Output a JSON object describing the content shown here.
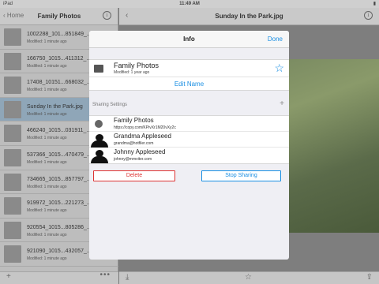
{
  "status": {
    "carrier": "iPad",
    "time": "11:49 AM",
    "battery": "▮"
  },
  "left": {
    "back_label": "Home",
    "title": "Family Photos",
    "info_label": "i",
    "files": [
      {
        "name": "1002288_101...851849_...",
        "modified": "Modified: 1 minute ago",
        "selected": false
      },
      {
        "name": "166750_1015...411312_...",
        "modified": "Modified: 1 minute ago",
        "selected": false
      },
      {
        "name": "17408_10151...668032_...",
        "modified": "Modified: 1 minute ago",
        "selected": false
      },
      {
        "name": "Sunday In the Park.jpg",
        "modified": "Modified: 1 minute ago",
        "selected": true
      },
      {
        "name": "466240_1015...031911_...",
        "modified": "Modified: 1 minute ago",
        "selected": false
      },
      {
        "name": "537366_1015...470479_...",
        "modified": "Modified: 1 minute ago",
        "selected": false
      },
      {
        "name": "734665_1015...857797_...",
        "modified": "Modified: 1 minute ago",
        "selected": false
      },
      {
        "name": "919972_1015...221273_...",
        "modified": "Modified: 1 minute ago",
        "selected": false
      },
      {
        "name": "920554_1015...805286_...",
        "modified": "Modified: 1 minute ago",
        "selected": false
      },
      {
        "name": "921090_1015...432057_...",
        "modified": "Modified: 1 minute ago",
        "selected": false
      }
    ],
    "add_label": "+",
    "more_label": "•••"
  },
  "right": {
    "back_label": "‹",
    "title": "Sunday In the Park.jpg",
    "info_label": "i",
    "toolbar": {
      "download": "⤓",
      "favorite": "☆",
      "share": "⇪"
    }
  },
  "modal": {
    "title": "Info",
    "done_label": "Done",
    "folder_name": "Family Photos",
    "folder_modified": "Modified: 1 year ago",
    "star_label": "☆",
    "edit_name_label": "Edit Name",
    "sharing_header": "Sharing Settings",
    "sharing_add": "+",
    "shares": [
      {
        "name": "Family Photos",
        "detail": "https://copy.com/KPivXr1M20vXy2c",
        "kind": "link"
      },
      {
        "name": "Grandma Appleseed",
        "detail": "grandma@hotfiler.com",
        "kind": "person"
      },
      {
        "name": "Johnny Appleseed",
        "detail": "johnny@mmviter.com",
        "kind": "person"
      }
    ],
    "delete_label": "Delete",
    "stop_sharing_label": "Stop Sharing"
  },
  "colors": {
    "accent": "#1a8fe3",
    "danger": "#dd3333"
  }
}
